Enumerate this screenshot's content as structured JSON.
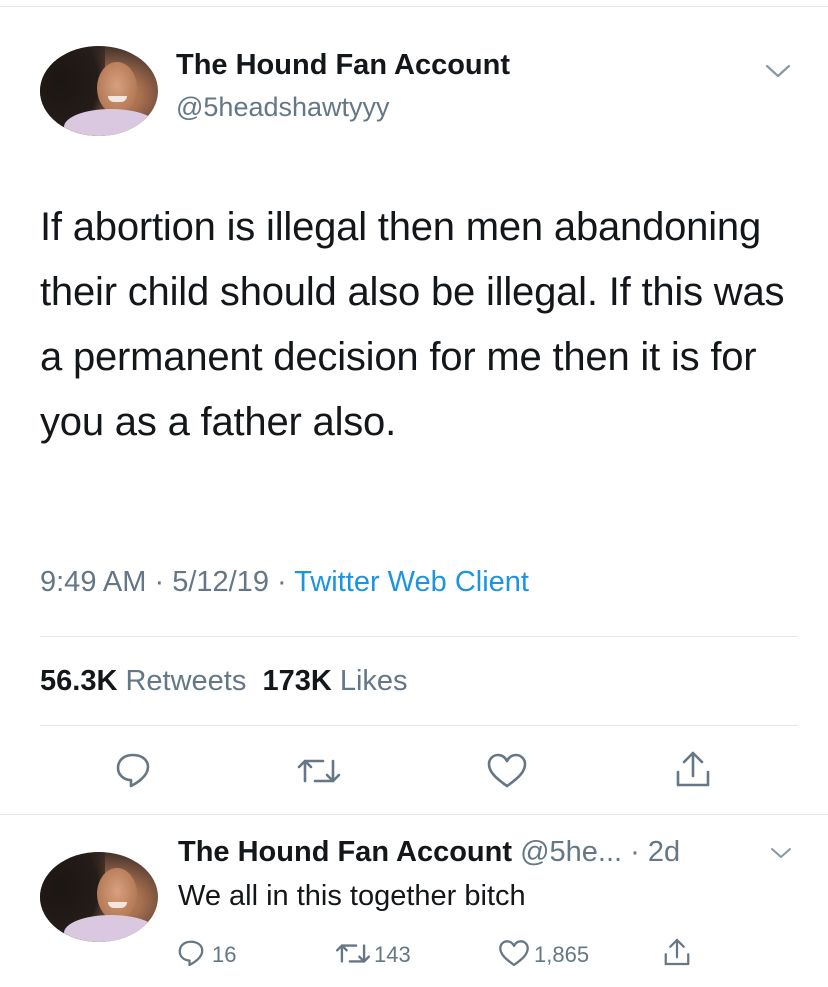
{
  "tweet": {
    "author_name": "The Hound Fan Account",
    "author_handle": "@5headshawtyyy",
    "text": "If abortion is illegal then men abandoning their child should also be illegal. If this was a permanent decision for me then it is for you as a father also.",
    "time": "9:49 AM",
    "date": "5/12/19",
    "client": "Twitter Web Client",
    "sep": " · ",
    "retweets_count": "56.3K",
    "retweets_label": "Retweets",
    "likes_count": "173K",
    "likes_label": "Likes"
  },
  "reply": {
    "author_name": "The Hound Fan Account",
    "author_handle_truncated": "@5he...",
    "age": "· 2d",
    "text": "We all in this together bitch",
    "reply_count": "16",
    "retweet_count": "143",
    "like_count": "1,865"
  },
  "colors": {
    "text": "#14171a",
    "secondary": "#657786",
    "link": "#1b95e0",
    "divider": "#e1e8ed"
  },
  "icons": [
    "chevron-down-icon",
    "reply-icon",
    "retweet-icon",
    "like-icon",
    "share-icon"
  ]
}
